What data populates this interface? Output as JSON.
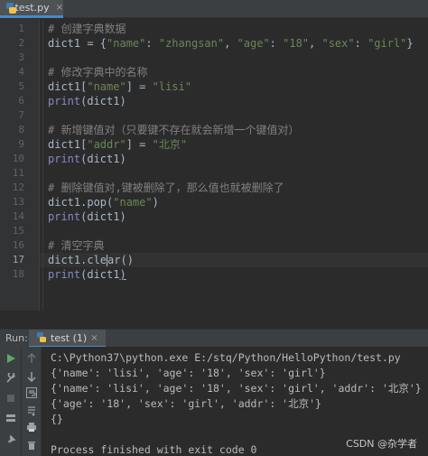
{
  "editor_tab": {
    "file_name": "test.py",
    "close_glyph": "×",
    "icon": "python-file-icon"
  },
  "editor": {
    "line_numbers": [
      "1",
      "2",
      "3",
      "4",
      "5",
      "6",
      "7",
      "8",
      "9",
      "10",
      "11",
      "12",
      "13",
      "14",
      "15",
      "16",
      "17",
      "18"
    ],
    "current_line": 17,
    "lines": [
      [
        {
          "t": "# 创建字典数据",
          "c": "comment"
        }
      ],
      [
        {
          "t": "dict1 = {",
          "c": "id"
        },
        {
          "t": "\"name\"",
          "c": "str"
        },
        {
          "t": ": ",
          "c": "id"
        },
        {
          "t": "\"zhangsan\"",
          "c": "str"
        },
        {
          "t": ", ",
          "c": "id"
        },
        {
          "t": "\"age\"",
          "c": "str"
        },
        {
          "t": ": ",
          "c": "id"
        },
        {
          "t": "\"18\"",
          "c": "str"
        },
        {
          "t": ", ",
          "c": "id"
        },
        {
          "t": "\"sex\"",
          "c": "str"
        },
        {
          "t": ": ",
          "c": "id"
        },
        {
          "t": "\"girl\"",
          "c": "str"
        },
        {
          "t": "}",
          "c": "id"
        }
      ],
      [],
      [
        {
          "t": "# 修改字典中的名称",
          "c": "comment"
        }
      ],
      [
        {
          "t": "dict1[",
          "c": "id"
        },
        {
          "t": "\"name\"",
          "c": "str"
        },
        {
          "t": "] = ",
          "c": "id"
        },
        {
          "t": "\"lisi\"",
          "c": "str"
        }
      ],
      [
        {
          "t": "print",
          "c": "fn"
        },
        {
          "t": "(dict1)",
          "c": "id"
        }
      ],
      [],
      [
        {
          "t": "# 新增键值对（只要键不存在就会新增一个键值对）",
          "c": "comment"
        }
      ],
      [
        {
          "t": "dict1[",
          "c": "id"
        },
        {
          "t": "\"addr\"",
          "c": "str"
        },
        {
          "t": "] = ",
          "c": "id"
        },
        {
          "t": "\"北京\"",
          "c": "str"
        }
      ],
      [
        {
          "t": "print",
          "c": "fn"
        },
        {
          "t": "(dict1)",
          "c": "id"
        }
      ],
      [],
      [
        {
          "t": "# 删除键值对,键被删除了，那么值也就被删除了",
          "c": "comment"
        }
      ],
      [
        {
          "t": "dict1.pop(",
          "c": "id"
        },
        {
          "t": "\"name\"",
          "c": "str"
        },
        {
          "t": ")",
          "c": "id"
        }
      ],
      [
        {
          "t": "print",
          "c": "fn"
        },
        {
          "t": "(dict1)",
          "c": "id"
        }
      ],
      [],
      [
        {
          "t": "# 清空字典",
          "c": "comment"
        }
      ],
      [
        {
          "t": "dict1.cle",
          "c": "id"
        },
        {
          "t": "CARET",
          "c": "caret"
        },
        {
          "t": "ar()",
          "c": "id"
        }
      ],
      [
        {
          "t": "print",
          "c": "fn"
        },
        {
          "t": "(dict1",
          "c": "id"
        },
        {
          "t": ")",
          "c": "under"
        }
      ]
    ]
  },
  "run_panel": {
    "label": "Run:",
    "tab_label": "test (1)",
    "tab_close": "×",
    "console": [
      "C:\\Python37\\python.exe E:/stq/Python/HelloPython/test.py",
      "{'name': 'lisi', 'age': '18', 'sex': 'girl'}",
      "{'name': 'lisi', 'age': '18', 'sex': 'girl', 'addr': '北京'}",
      "{'age': '18', 'sex': 'girl', 'addr': '北京'}",
      "{}",
      "",
      "Process finished with exit code 0"
    ]
  },
  "watermark": "CSDN @杂学者",
  "colors": {
    "accent": "#4a88c7",
    "run_green": "#59a869",
    "stop_red": "#c75450"
  }
}
